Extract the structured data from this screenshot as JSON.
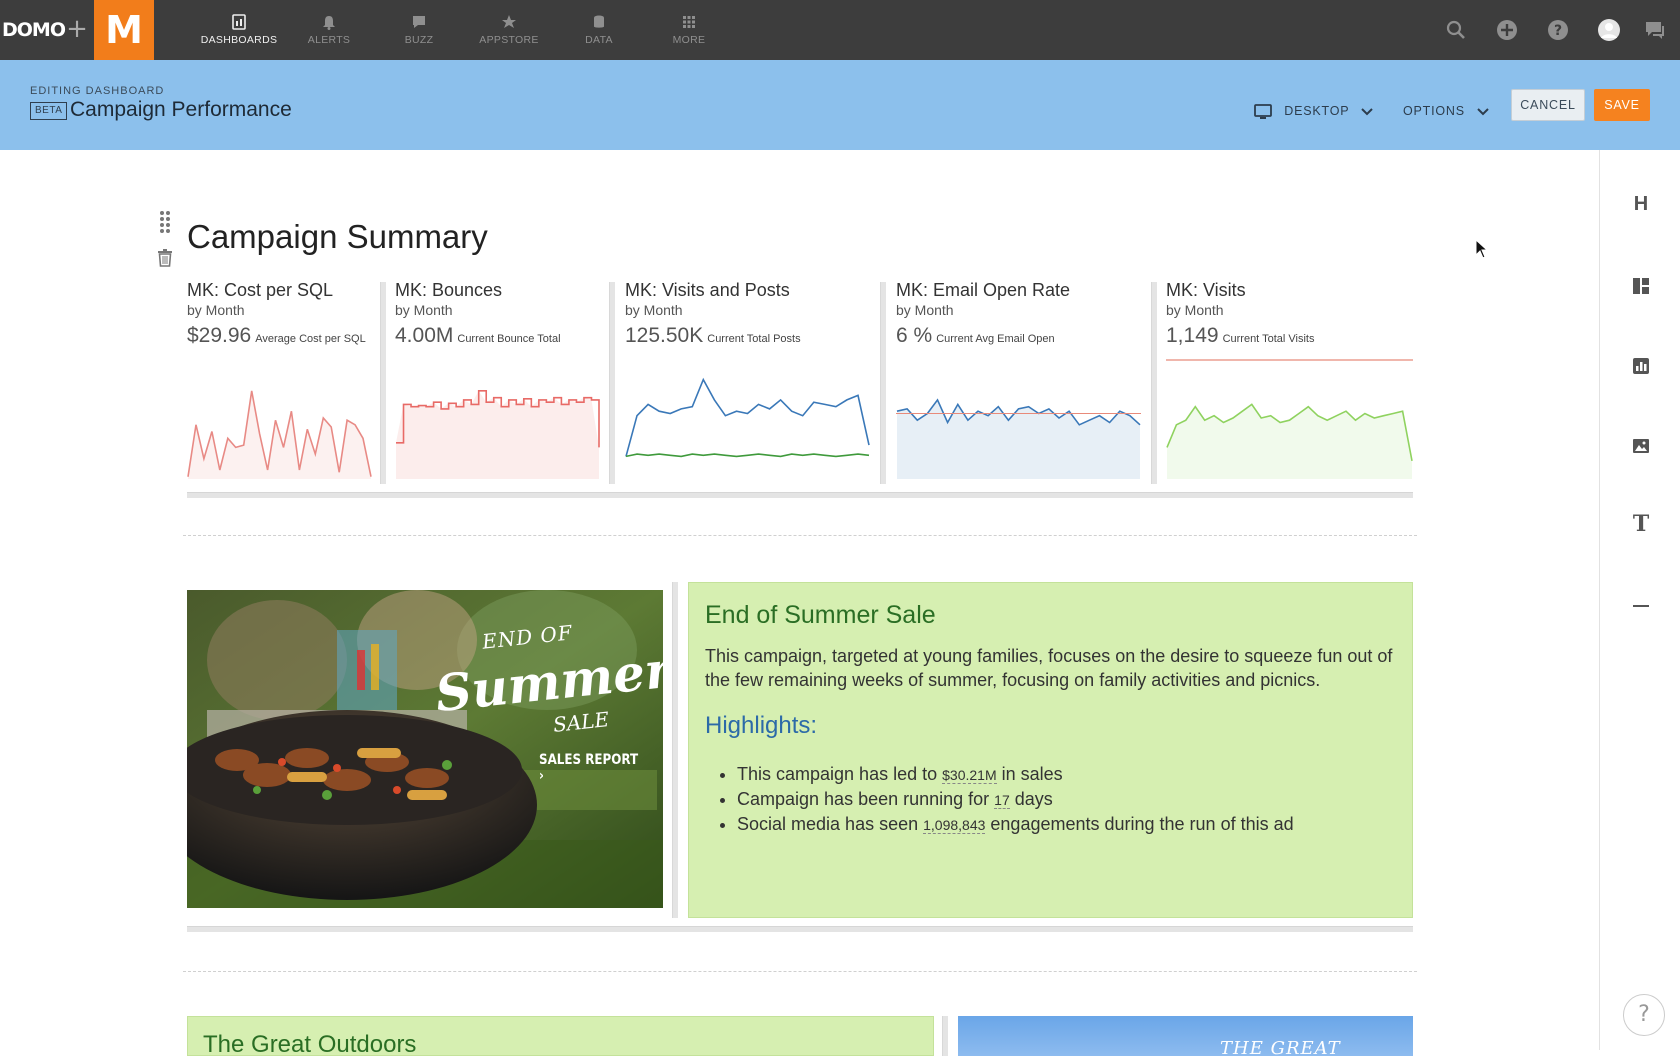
{
  "topnav": {
    "logo_text": "DOMO",
    "m_logo": "M",
    "items": [
      {
        "label": "DASHBOARDS",
        "icon": "dashboards-icon",
        "active": true
      },
      {
        "label": "ALERTS",
        "icon": "bell-icon",
        "active": false
      },
      {
        "label": "BUZZ",
        "icon": "chat-icon",
        "active": false
      },
      {
        "label": "APPSTORE",
        "icon": "appstore-icon",
        "active": false
      },
      {
        "label": "DATA",
        "icon": "database-icon",
        "active": false
      },
      {
        "label": "MORE",
        "icon": "grid-icon",
        "active": false
      }
    ],
    "right_icons": [
      "search-icon",
      "add-circle-icon",
      "help-icon",
      "avatar",
      "messages-icon"
    ]
  },
  "editbar": {
    "caption": "EDITING DASHBOARD",
    "beta": "BETA",
    "title": "Campaign Performance",
    "view_label": "DESKTOP",
    "options_label": "OPTIONS",
    "cancel_label": "CANCEL",
    "save_label": "SAVE"
  },
  "colors": {
    "nav_bg": "#3d3d3d",
    "brand_orange": "#f27d1b",
    "editbar_bg": "#8cc0ec",
    "save_bg": "#f5821f",
    "text_block_bg": "#d6efb1"
  },
  "section": {
    "title": "Campaign Summary"
  },
  "cards": [
    {
      "title": "MK: Cost per SQL",
      "subtitle": "by Month",
      "value": "$29.96",
      "value_label": "Average Cost per SQL"
    },
    {
      "title": "MK: Bounces",
      "subtitle": "by Month",
      "value": "4.00M",
      "value_label": "Current Bounce Total"
    },
    {
      "title": "MK: Visits and Posts",
      "subtitle": "by Month",
      "value": "125.50K",
      "value_label": "Current Total Posts"
    },
    {
      "title": "MK: Email Open Rate",
      "subtitle": "by Month",
      "value": "6 %",
      "value_label": "Current Avg Email Open"
    },
    {
      "title": "MK: Visits",
      "subtitle": "by Month",
      "value": "1,149",
      "value_label": "Current Total Visits"
    }
  ],
  "chart_data": [
    {
      "type": "line",
      "title": "MK: Cost per SQL",
      "series": [
        {
          "values": [
            2,
            48,
            18,
            42,
            8,
            36,
            28,
            30,
            78,
            40,
            8,
            52,
            28,
            60,
            8,
            44,
            22,
            54,
            46,
            6,
            52,
            48,
            36,
            2
          ]
        }
      ],
      "color": "#e88a85"
    },
    {
      "type": "line",
      "title": "MK: Bounces",
      "series": [
        {
          "values": [
            32,
            66,
            64,
            65,
            64,
            68,
            62,
            67,
            64,
            70,
            66,
            78,
            68,
            72,
            64,
            70,
            66,
            71,
            64,
            70,
            68,
            72,
            66,
            70,
            68,
            72,
            70,
            28
          ]
        }
      ],
      "color": "#e86a66"
    },
    {
      "type": "line",
      "title": "MK: Visits and Posts",
      "series": [
        {
          "name": "Visits",
          "values": [
            20,
            56,
            66,
            60,
            58,
            62,
            64,
            88,
            70,
            56,
            60,
            58,
            66,
            62,
            70,
            60,
            56,
            68,
            66,
            64,
            70,
            74,
            30
          ]
        },
        {
          "name": "Posts",
          "values": [
            20,
            22,
            21,
            22,
            21,
            20,
            22,
            21,
            22,
            21,
            20,
            21,
            22,
            21,
            20,
            22,
            21,
            22,
            21,
            20,
            21,
            22,
            21
          ]
        }
      ],
      "colors": [
        "#3a78b8",
        "#3f9a3c"
      ]
    },
    {
      "type": "area",
      "title": "MK: Email Open Rate",
      "series": [
        {
          "values": [
            60,
            62,
            52,
            58,
            70,
            50,
            66,
            52,
            60,
            56,
            64,
            52,
            62,
            64,
            58,
            62,
            54,
            60,
            48,
            52,
            56,
            50,
            60,
            56,
            48
          ]
        }
      ],
      "color": "#3a78b8"
    },
    {
      "type": "area",
      "title": "MK: Visits",
      "series": [
        {
          "values": [
            28,
            48,
            52,
            64,
            52,
            56,
            50,
            54,
            60,
            66,
            54,
            56,
            50,
            52,
            58,
            64,
            56,
            52,
            56,
            60,
            52,
            58,
            54,
            56,
            58,
            60,
            16
          ]
        }
      ],
      "color": "#8fd25f"
    }
  ],
  "promo": {
    "line1": "END OF",
    "line2": "Summer",
    "line3": "SALE",
    "cta": "SALES REPORT ›"
  },
  "text_block": {
    "title": "End of Summer Sale",
    "body": "This campaign, targeted at young families, focuses on the desire to squeeze fun out of the few remaining weeks of summer, focusing on family activities and picnics.",
    "highlights_title": "Highlights:",
    "items": [
      {
        "pre": "This campaign has led to ",
        "num": "$30.21M",
        "post": " in sales"
      },
      {
        "pre": "Campaign has been running for ",
        "num": "17",
        "post": " days"
      },
      {
        "pre": "Social media has seen ",
        "num": "1,098,843",
        "post": " engagements during the run of this ad"
      }
    ]
  },
  "bottom": {
    "left_title": "The Great Outdoors",
    "right_text": "THE GREAT"
  },
  "right_toolbar": {
    "items": [
      "heading-icon",
      "layout-icon",
      "chart-icon",
      "image-icon",
      "text-icon",
      "divider-icon"
    ],
    "heading_glyph": "H",
    "text_glyph": "T",
    "help": "?"
  }
}
